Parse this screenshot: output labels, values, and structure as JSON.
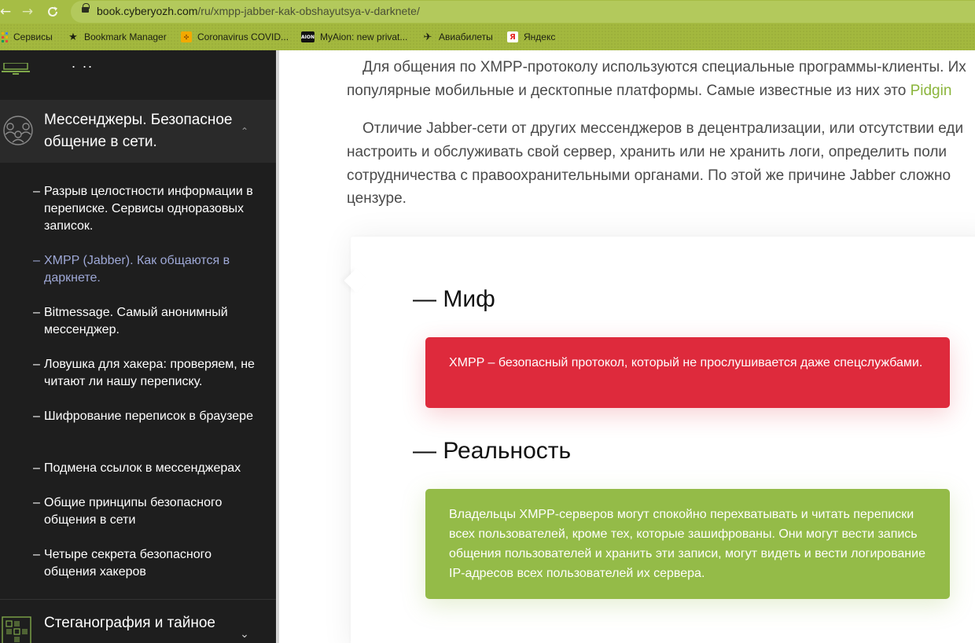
{
  "browser": {
    "url_host": "book.cyberyozh.com",
    "url_path": "/ru/xmpp-jabber-kak-obshayutsya-v-darknete/",
    "icons": [
      "back-arrow-icon",
      "forward-arrow-icon",
      "reload-icon",
      "lock-icon"
    ]
  },
  "bookmarks": [
    {
      "label": "Сервисы",
      "icon": "apps-grid-icon"
    },
    {
      "label": "Bookmark Manager",
      "icon": "star-icon"
    },
    {
      "label": "Coronavirus COVID...",
      "icon": "coronavirus-site-icon"
    },
    {
      "label": "MyAion: new privat...",
      "icon": "aion-logo-icon"
    },
    {
      "label": "Авиабилеты",
      "icon": "airplane-icon"
    },
    {
      "label": "Яндекс",
      "icon": "yandex-logo-icon"
    }
  ],
  "sidebar": {
    "top_partial_text": ". ..",
    "active_section": {
      "title": "Мессенджеры. Безопасное общение в сети.",
      "expanded": true
    },
    "items": [
      {
        "label": "Разрыв целостности информации в переписке. Сервисы одноразовых записок.",
        "active": false
      },
      {
        "label": "XMPP (Jabber). Как общаются в даркнете.",
        "active": true
      },
      {
        "label": "Bitmessage. Самый анонимный мессенджер.",
        "active": false
      },
      {
        "label": "Ловушка для хакера: проверяем, не читают ли нашу переписку.",
        "active": false
      },
      {
        "label": "Шифрование переписок в браузере",
        "active": false
      },
      {
        "label": "Подмена ссылок в мессенджерах",
        "active": false
      },
      {
        "label": "Общие принципы безопасного общения в сети",
        "active": false
      },
      {
        "label": "Четыре секрета безопасного общения хакеров",
        "active": false
      }
    ],
    "next_section": {
      "title": "Стеганография и тайное",
      "expanded": false
    },
    "dash": "–"
  },
  "content": {
    "paragraph1": [
      "Для общения по XMPP-протоколу используются специальные программы-клиенты. Их",
      "популярные мобильные и десктопные платформы. Самые известные из них это "
    ],
    "paragraph1_link": "Pidgin",
    "paragraph2": [
      "Отличие Jabber-сети от других мессенджеров в децентрализации, или отсутствии еди",
      "настроить и обслуживать свой сервер, хранить или не хранить логи, определить поли",
      "сотрудничества с правоохранительными органами. По этой же причине Jabber сложно",
      "цензуре."
    ],
    "myth_heading": "— Миф",
    "myth_text": "XMPP – безопасный протокол, который не прослушивается даже спецслужбами.",
    "reality_heading": "— Реальность",
    "reality_text": "Владельцы XMPP-серверов могут спокойно перехватывать и читать переписки всех пользователей, кроме тех, которые зашифрованы. Они могут вести запись общения пользователей и хранить эти записи, могут видеть и вести логирование IP-адресов всех пользователей их сервера."
  },
  "colors": {
    "chrome": "#a6bd45",
    "sidebar_bg": "#1e1e1e",
    "active_link": "#9ea8d6",
    "myth": "#de2a3c",
    "reality": "#94bb48",
    "link": "#8bb53c"
  }
}
